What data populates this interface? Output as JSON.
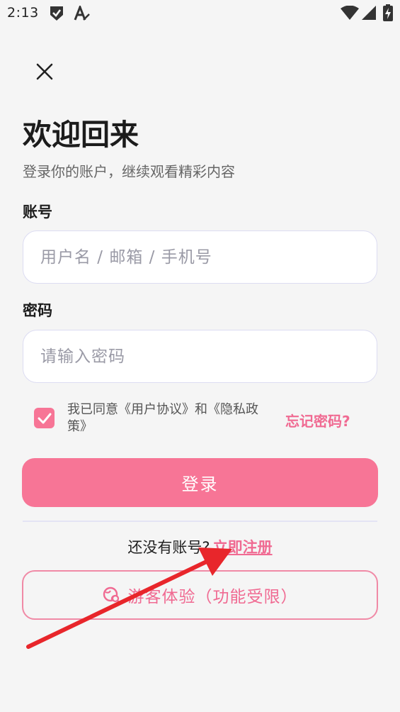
{
  "status_bar": {
    "time": "2:13",
    "icons": [
      "shield-check-icon",
      "font-a-icon",
      "wifi-icon",
      "signal-icon",
      "battery-charging-icon"
    ]
  },
  "header": {
    "close_icon": "close-icon",
    "title": "欢迎回来",
    "subtitle": "登录你的账户，继续观看精彩内容"
  },
  "form": {
    "account_label": "账号",
    "account_placeholder": "用户名 / 邮箱 / 手机号",
    "account_value": "",
    "password_label": "密码",
    "password_placeholder": "请输入密码",
    "password_value": "",
    "agree_checked": true,
    "agree_text": "我已同意《用户协议》和《隐私政策》",
    "forgot_label": "忘记密码?",
    "login_label": "登录"
  },
  "footer": {
    "register_question": "还没有账号?",
    "register_link": "立即注册",
    "guest_label": "游客体验（功能受限）"
  },
  "colors": {
    "accent": "#f77596",
    "accent_text": "#f06a92",
    "annotation_arrow": "#e8262b"
  }
}
